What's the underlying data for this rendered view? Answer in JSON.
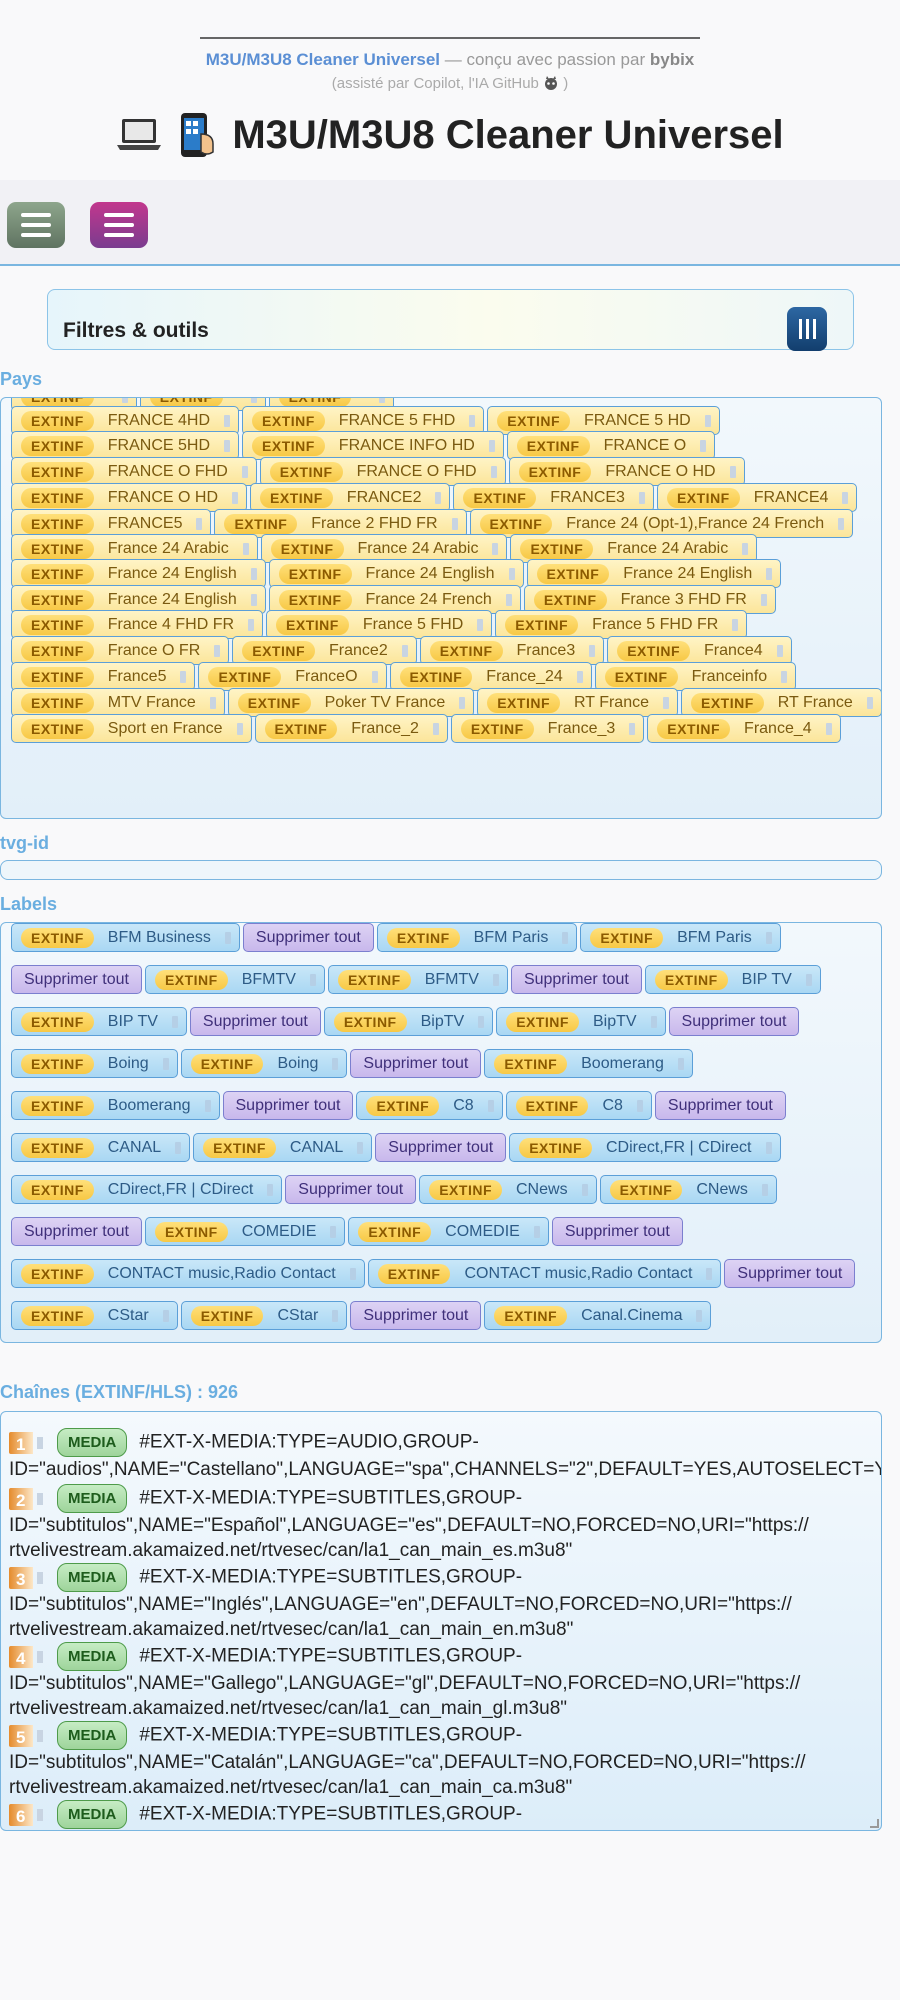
{
  "header": {
    "app_name": "M3U/M3U8 Cleaner Universel",
    "credit_text": "— conçu avec passion par",
    "author": "bybix",
    "assist_text": "(assisté par Copilot, l'IA GitHub",
    "assist_close": ")",
    "title": "M3U/M3U8 Cleaner Universel"
  },
  "filters": {
    "title": "Filtres & outils"
  },
  "sections": {
    "pays": "Pays",
    "tvg": "tvg-id",
    "labels": "Labels",
    "channels": "Chaînes (EXTINF/HLS) : 926"
  },
  "ext_label": "EXTINF",
  "pays_rows": [
    [
      "",
      "",
      ""
    ],
    [
      "FRANCE 4HD",
      "FRANCE 5 FHD",
      "FRANCE 5 HD"
    ],
    [
      "FRANCE 5HD",
      "FRANCE INFO HD",
      "FRANCE O"
    ],
    [
      "FRANCE O FHD",
      "FRANCE O FHD",
      "FRANCE O HD"
    ],
    [
      "FRANCE O HD",
      "FRANCE2",
      "FRANCE3",
      "FRANCE4"
    ],
    [
      "FRANCE5",
      "France 2 FHD FR",
      "France 24 (Opt-1),France 24 French"
    ],
    [
      "France 24 Arabic",
      "France 24 Arabic",
      "France 24 Arabic"
    ],
    [
      "France 24 English",
      "France 24 English",
      "France 24 English"
    ],
    [
      "France 24 English",
      "France 24 French",
      "France 3 FHD FR"
    ],
    [
      "France 4 FHD FR",
      "France 5 FHD",
      "France 5 FHD FR"
    ],
    [
      "France O FR",
      "France2",
      "France3",
      "France4"
    ],
    [
      "France5",
      "FranceO",
      "France_24",
      "Franceinfo"
    ],
    [
      "MTV France",
      "Poker TV France",
      "RT France",
      "RT France"
    ],
    [
      "Sport en France",
      "France_2",
      "France_3",
      "France_4"
    ]
  ],
  "labels_rows": [
    [
      {
        "t": "tag",
        "v": "BFM Business"
      },
      {
        "t": "chip",
        "v": "Supprimer tout"
      },
      {
        "t": "tag",
        "v": "BFM Paris"
      },
      {
        "t": "tag",
        "v": "BFM Paris"
      }
    ],
    [
      {
        "t": "chip",
        "v": "Supprimer tout"
      },
      {
        "t": "tag",
        "v": "BFMTV"
      },
      {
        "t": "tag",
        "v": "BFMTV"
      },
      {
        "t": "chip",
        "v": "Supprimer tout"
      },
      {
        "t": "tag",
        "v": "BIP TV"
      }
    ],
    [
      {
        "t": "tag",
        "v": "BIP TV"
      },
      {
        "t": "chip",
        "v": "Supprimer tout"
      },
      {
        "t": "tag",
        "v": "BipTV"
      },
      {
        "t": "tag",
        "v": "BipTV"
      },
      {
        "t": "chip",
        "v": "Supprimer tout"
      }
    ],
    [
      {
        "t": "tag",
        "v": "Boing"
      },
      {
        "t": "tag",
        "v": "Boing"
      },
      {
        "t": "chip",
        "v": "Supprimer tout"
      },
      {
        "t": "tag",
        "v": "Boomerang"
      }
    ],
    [
      {
        "t": "tag",
        "v": "Boomerang"
      },
      {
        "t": "chip",
        "v": "Supprimer tout"
      },
      {
        "t": "tag",
        "v": "C8"
      },
      {
        "t": "tag",
        "v": "C8"
      },
      {
        "t": "chip",
        "v": "Supprimer tout"
      }
    ],
    [
      {
        "t": "tag",
        "v": "CANAL"
      },
      {
        "t": "tag",
        "v": "CANAL"
      },
      {
        "t": "chip",
        "v": "Supprimer tout"
      },
      {
        "t": "tag",
        "v": "CDirect,FR | CDirect"
      }
    ],
    [
      {
        "t": "tag",
        "v": "CDirect,FR | CDirect"
      },
      {
        "t": "chip",
        "v": "Supprimer tout"
      },
      {
        "t": "tag",
        "v": "CNews"
      },
      {
        "t": "tag",
        "v": "CNews"
      }
    ],
    [
      {
        "t": "chip",
        "v": "Supprimer tout"
      },
      {
        "t": "tag",
        "v": "COMEDIE"
      },
      {
        "t": "tag",
        "v": "COMEDIE"
      },
      {
        "t": "chip",
        "v": "Supprimer tout"
      }
    ],
    [
      {
        "t": "tag",
        "v": "CONTACT music,Radio Contact"
      },
      {
        "t": "tag",
        "v": "CONTACT music,Radio Contact"
      },
      {
        "t": "chip",
        "v": "Supprimer tout"
      }
    ],
    [
      {
        "t": "tag",
        "v": "CStar"
      },
      {
        "t": "tag",
        "v": "CStar"
      },
      {
        "t": "chip",
        "v": "Supprimer tout"
      },
      {
        "t": "tag",
        "v": "Canal.Cinema"
      }
    ]
  ],
  "media_label": "MEDIA",
  "channels": [
    {
      "num": "1",
      "l1": "#EXT-X-MEDIA:TYPE=AUDIO,GROUP-",
      "l2": "ID=\"audios\",NAME=\"Castellano\",LANGUAGE=\"spa\",CHANNELS=\"2\",DEFAULT=YES,AUTOSELECT=YES",
      "l3": ""
    },
    {
      "num": "2",
      "l1": "#EXT-X-MEDIA:TYPE=SUBTITLES,GROUP-",
      "l2": "ID=\"subtitulos\",NAME=\"Español\",LANGUAGE=\"es\",DEFAULT=NO,FORCED=NO,URI=\"https://",
      "l3": "rtvelivestream.akamaized.net/rtvesec/can/la1_can_main_es.m3u8\""
    },
    {
      "num": "3",
      "l1": "#EXT-X-MEDIA:TYPE=SUBTITLES,GROUP-",
      "l2": "ID=\"subtitulos\",NAME=\"Inglés\",LANGUAGE=\"en\",DEFAULT=NO,FORCED=NO,URI=\"https://",
      "l3": "rtvelivestream.akamaized.net/rtvesec/can/la1_can_main_en.m3u8\""
    },
    {
      "num": "4",
      "l1": "#EXT-X-MEDIA:TYPE=SUBTITLES,GROUP-",
      "l2": "ID=\"subtitulos\",NAME=\"Gallego\",LANGUAGE=\"gl\",DEFAULT=NO,FORCED=NO,URI=\"https://",
      "l3": "rtvelivestream.akamaized.net/rtvesec/can/la1_can_main_gl.m3u8\""
    },
    {
      "num": "5",
      "l1": "#EXT-X-MEDIA:TYPE=SUBTITLES,GROUP-",
      "l2": "ID=\"subtitulos\",NAME=\"Catalán\",LANGUAGE=\"ca\",DEFAULT=NO,FORCED=NO,URI=\"https://",
      "l3": "rtvelivestream.akamaized.net/rtvesec/can/la1_can_main_ca.m3u8\""
    },
    {
      "num": "6",
      "l1": "#EXT-X-MEDIA:TYPE=SUBTITLES,GROUP-",
      "l2": "",
      "l3": ""
    }
  ],
  "colors": {
    "accent_blue": "#6aaee0",
    "tag_yellow": "#fbe59a",
    "tag_blue": "#a9d7f3",
    "chip_purple": "#c8b8ec",
    "media_green": "#9ed49b"
  },
  "icons": [
    "laptop-icon",
    "phone-icon",
    "menu-icon",
    "sliders-icon"
  ]
}
